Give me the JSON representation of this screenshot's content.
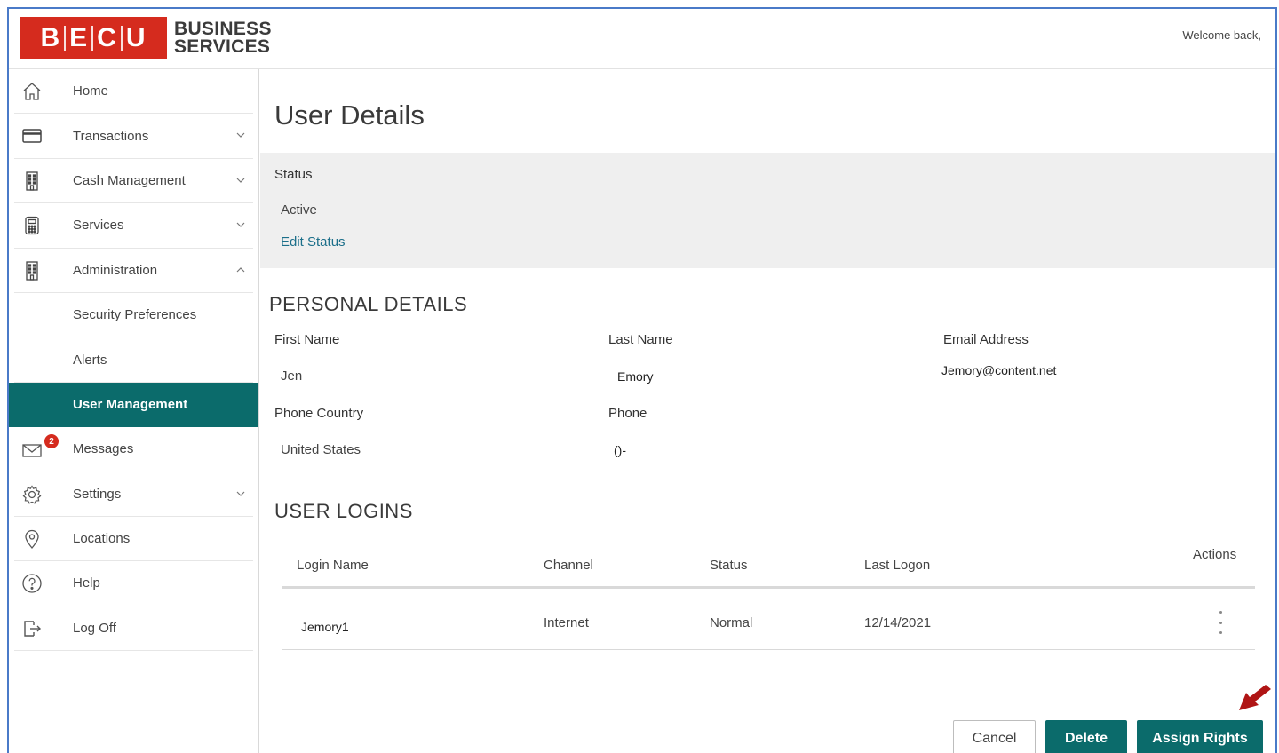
{
  "brand": {
    "logo_letters": "B|E|C|U",
    "line1": "BUSINESS",
    "line2": "SERVICES",
    "color": "#d52b1e"
  },
  "header": {
    "welcome": "Welcome back,"
  },
  "sidebar": {
    "items": [
      {
        "label": "Home",
        "icon": "home-icon",
        "expandable": false
      },
      {
        "label": "Transactions",
        "icon": "card-icon",
        "expandable": true
      },
      {
        "label": "Cash Management",
        "icon": "building-icon",
        "expandable": true
      },
      {
        "label": "Services",
        "icon": "calculator-icon",
        "expandable": true
      },
      {
        "label": "Administration",
        "icon": "building-icon",
        "expandable": true,
        "expanded": true
      },
      {
        "label": "Security Preferences",
        "sub": true
      },
      {
        "label": "Alerts",
        "sub": true
      },
      {
        "label": "User Management",
        "sub": true,
        "active": true
      },
      {
        "label": "Messages",
        "icon": "envelope-icon",
        "badge": "2"
      },
      {
        "label": "Settings",
        "icon": "gear-icon",
        "expandable": true
      },
      {
        "label": "Locations",
        "icon": "location-pin-icon"
      },
      {
        "label": "Help",
        "icon": "help-icon"
      },
      {
        "label": "Log Off",
        "icon": "logout-icon"
      }
    ],
    "active_color": "#0b6b6b"
  },
  "page": {
    "title": "User Details"
  },
  "status": {
    "heading": "Status",
    "value": "Active",
    "edit_link": "Edit Status"
  },
  "personal": {
    "heading": "PERSONAL DETAILS",
    "first_name_label": "First Name",
    "first_name": "Jen",
    "last_name_label": "Last Name",
    "last_name": "Emory",
    "email_label": "Email Address",
    "email": "Jemory@content.net",
    "phone_country_label": "Phone Country",
    "phone_country": "United States",
    "phone_label": "Phone",
    "phone": "()-"
  },
  "logins": {
    "heading": "USER LOGINS",
    "columns": {
      "login_name": "Login Name",
      "channel": "Channel",
      "status": "Status",
      "last_logon": "Last Logon",
      "actions": "Actions"
    },
    "rows": [
      {
        "login_name": "Jemory1",
        "channel": "Internet",
        "status": "Normal",
        "last_logon": "12/14/2021"
      }
    ]
  },
  "buttons": {
    "cancel": "Cancel",
    "delete": "Delete",
    "assign": "Assign Rights"
  },
  "annotation": {
    "arrow_color": "#b01515"
  }
}
